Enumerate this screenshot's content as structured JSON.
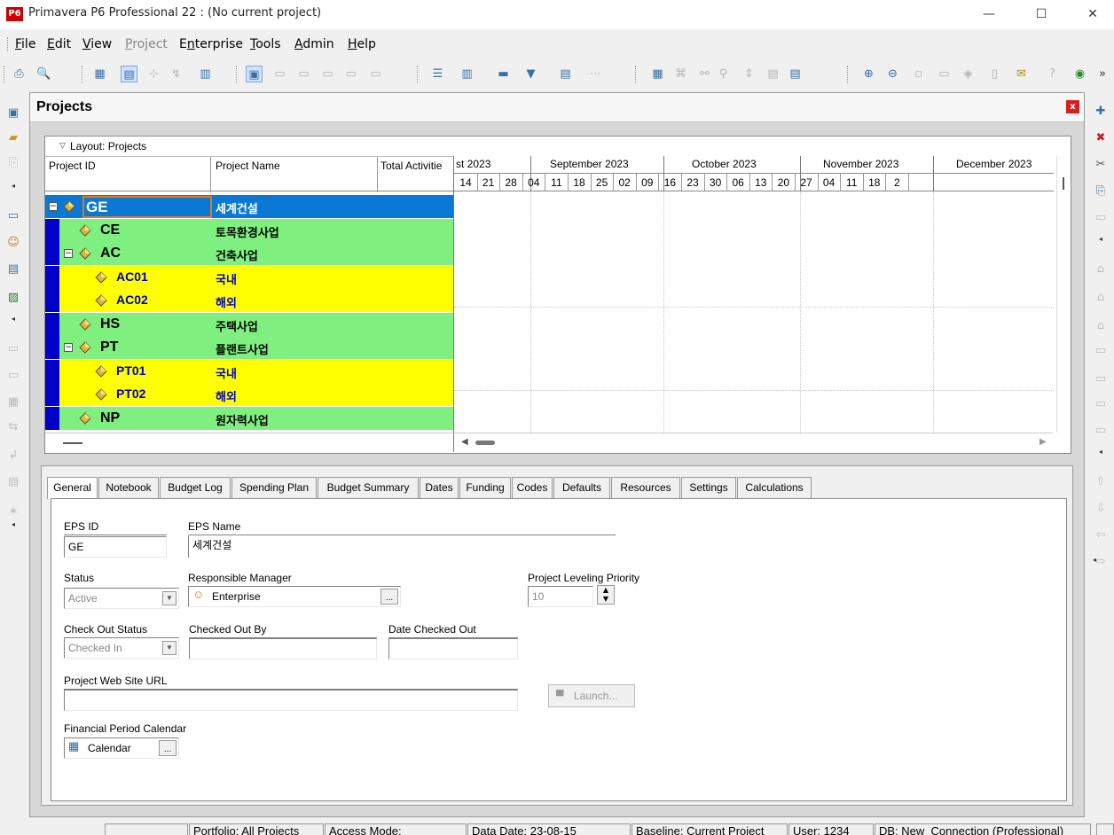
{
  "window": {
    "logo": "P6",
    "title": "Primavera P6 Professional 22 : (No current project)",
    "minimize": "—",
    "maximize": "☐",
    "close": "✕"
  },
  "menu": [
    {
      "pre": "",
      "u": "F",
      "post": "ile"
    },
    {
      "pre": "",
      "u": "E",
      "post": "dit"
    },
    {
      "pre": "",
      "u": "V",
      "post": "iew"
    },
    {
      "pre": "",
      "u": "P",
      "post": "roject"
    },
    {
      "pre": "E",
      "u": "n",
      "post": "terprise"
    },
    {
      "pre": "",
      "u": "T",
      "post": "ools"
    },
    {
      "pre": "",
      "u": "A",
      "post": "dmin"
    },
    {
      "pre": "",
      "u": "H",
      "post": "elp"
    }
  ],
  "panel": {
    "title": "Projects",
    "close": "x"
  },
  "grid": {
    "layout_label": "Layout: Projects",
    "columns": [
      "Project ID",
      "Project Name",
      "Total Activitie"
    ],
    "months": [
      "st 2023",
      "September 2023",
      "October 2023",
      "November 2023",
      "December 2023"
    ],
    "weeks": [
      "14",
      "21",
      "28",
      "04",
      "11",
      "18",
      "25",
      "02",
      "09",
      "16",
      "23",
      "30",
      "06",
      "13",
      "20",
      "27",
      "04",
      "11",
      "18",
      "2"
    ],
    "rows": [
      {
        "id": "GE",
        "name": "세계건설",
        "level": 1,
        "expander": "−"
      },
      {
        "id": "CE",
        "name": "토목환경사업",
        "level": 2,
        "expander": ""
      },
      {
        "id": "AC",
        "name": "건축사업",
        "level": 2,
        "expander": "−"
      },
      {
        "id": "AC01",
        "name": "국내",
        "level": 3,
        "expander": ""
      },
      {
        "id": "AC02",
        "name": "해외",
        "level": 3,
        "expander": ""
      },
      {
        "id": "HS",
        "name": "주택사업",
        "level": 2,
        "expander": ""
      },
      {
        "id": "PT",
        "name": "플랜트사업",
        "level": 2,
        "expander": "−"
      },
      {
        "id": "PT01",
        "name": "국내",
        "level": 3,
        "expander": ""
      },
      {
        "id": "PT02",
        "name": "해외",
        "level": 3,
        "expander": ""
      },
      {
        "id": "NP",
        "name": "원자력사업",
        "level": 2,
        "expander": ""
      }
    ]
  },
  "tabs": [
    "General",
    "Notebook",
    "Budget Log",
    "Spending Plan",
    "Budget Summary",
    "Dates",
    "Funding",
    "Codes",
    "Defaults",
    "Resources",
    "Settings",
    "Calculations"
  ],
  "general": {
    "eps_id_label": "EPS ID",
    "eps_id": "GE",
    "eps_name_label": "EPS Name",
    "eps_name": "세계건설",
    "status_label": "Status",
    "status": "Active",
    "manager_label": "Responsible Manager",
    "manager": "Enterprise",
    "manager_btn": "...",
    "leveling_label": "Project Leveling Priority",
    "leveling": "10",
    "checkout_status_label": "Check Out Status",
    "checkout_status": "Checked In",
    "checked_out_by_label": "Checked Out By",
    "checked_out_by": "",
    "date_checked_out_label": "Date Checked Out",
    "date_checked_out": "",
    "url_label": "Project Web Site URL",
    "url": "",
    "launch": "Launch...",
    "calendar_label": "Financial Period Calendar",
    "calendar": "Calendar",
    "calendar_btn": "..."
  },
  "status_bar": {
    "portfolio": "Portfolio: All Projects",
    "access": "Access Mode:",
    "data_date": "Data Date: 23-08-15",
    "baseline": "Baseline: Current Project",
    "user": "User: 1234",
    "db": "DB: New_Connection (Professional)"
  },
  "colors": {
    "selected_row": "#0a79d6",
    "level2_row": "#7ff07f",
    "level3_row": "#ffff00",
    "wbs_bar": "#0000c8"
  }
}
